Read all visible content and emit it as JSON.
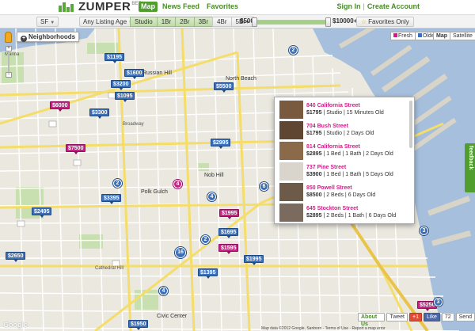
{
  "header": {
    "logo_text": "ZUMPER",
    "logo_badge": "BETA",
    "nav": [
      "Map",
      "News Feed",
      "Favorites"
    ],
    "sign_in": "Sign In",
    "separator": "|",
    "create_account": "Create Account"
  },
  "filters": {
    "city": "SF",
    "listing_age": "Any Listing Age",
    "beds": [
      {
        "label": "Studio",
        "on": true
      },
      {
        "label": "1Br",
        "on": true
      },
      {
        "label": "2Br",
        "on": true
      },
      {
        "label": "3Br",
        "on": true
      },
      {
        "label": "4Br",
        "on": false
      },
      {
        "label": "5Br+",
        "on": false
      }
    ],
    "price_min": "$500",
    "price_max": "$10000+",
    "favorites_only": "Favorites Only"
  },
  "map_controls": {
    "neighborhoods": "Neighborhoods",
    "legend_fresh": "Fresh",
    "legend_older": "Older",
    "map": "Map",
    "satellite": "Satellite",
    "fresh_color": "#cc1f86",
    "older_color": "#3d6fb7"
  },
  "markers": [
    {
      "label": "$1195",
      "color": "blue"
    },
    {
      "label": "$1600",
      "color": "blue"
    },
    {
      "label": "$3200",
      "color": "blue"
    },
    {
      "label": "$1095",
      "color": "blue"
    },
    {
      "label": "$5500",
      "color": "blue"
    },
    {
      "label": "$6000",
      "color": "pink"
    },
    {
      "label": "$3300",
      "color": "blue"
    },
    {
      "label": "$7500",
      "color": "pink"
    },
    {
      "label": "$2995",
      "color": "blue"
    },
    {
      "label": "$2495",
      "color": "blue"
    },
    {
      "label": "$3395",
      "color": "blue"
    },
    {
      "label": "$1995",
      "color": "pink"
    },
    {
      "label": "$1695",
      "color": "blue"
    },
    {
      "label": "$1595",
      "color": "pink"
    },
    {
      "label": "$2650",
      "color": "blue"
    },
    {
      "label": "$1995",
      "color": "blue"
    },
    {
      "label": "$1395",
      "color": "blue"
    },
    {
      "label": "$1950",
      "color": "blue"
    },
    {
      "label": "$5250",
      "color": "pink"
    }
  ],
  "clusters": [
    "2",
    "2",
    "4",
    "4",
    "6",
    "2",
    "16",
    "4",
    "3",
    "3"
  ],
  "places": [
    "Marina",
    "Russian Hill",
    "North Beach",
    "Nob Hill",
    "Polk Gulch",
    "Civic Center",
    "Cathedral Hill",
    "Broadway"
  ],
  "popup": {
    "listings": [
      {
        "address": "840 California Street",
        "price": "$1795",
        "details": "Studio | 15 Minutes Old",
        "thumb_color": "#7a5a3e"
      },
      {
        "address": "704 Bush Street",
        "price": "$1795",
        "details": "Studio | 2 Days Old",
        "thumb_color": "#5e4632"
      },
      {
        "address": "814 California Street",
        "price": "$2895",
        "details": "1 Bed | 1 Bath | 2 Days Old",
        "thumb_color": "#8b6a4a"
      },
      {
        "address": "737 Pine Street",
        "price": "$3900",
        "details": "1 Bed | 1 Bath | 5 Days Old",
        "thumb_color": "#d9d4cc"
      },
      {
        "address": "850 Powell Street",
        "price": "$8500",
        "details": "2 Beds | 6 Days Old",
        "thumb_color": "#6e5a48"
      },
      {
        "address": "645 Stockton Street",
        "price": "$2895",
        "details": "2 Beds | 1 Bath | 6 Days Old",
        "thumb_color": "#7b6b5e"
      }
    ]
  },
  "feedback": "feedback",
  "social": {
    "about": "About Us",
    "tweet": "Tweet",
    "gplus": "+1",
    "like": "Like",
    "like_count": "72",
    "send": "Send"
  },
  "attribution": "Map data ©2012 Google, Sanborn · Terms of Use · Report a map error",
  "google": "Google"
}
